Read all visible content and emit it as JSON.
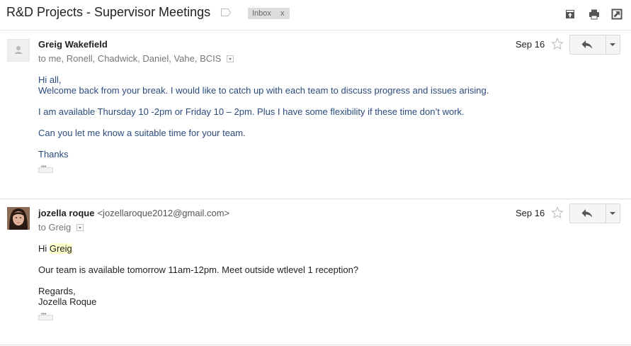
{
  "subject": "R&D Projects - Supervisor Meetings",
  "inbox_chip": {
    "label": "Inbox",
    "close": "x"
  },
  "header_icons": [
    "archive-icon",
    "print-icon",
    "new-window-icon"
  ],
  "messages": [
    {
      "sender": "Greig Wakefield",
      "sender_email": "",
      "recipients": "to me, Ronell, Chadwick, Daniel, Vahe, BCIS",
      "date": "Sep 16",
      "avatar": "default-avatar",
      "body": [
        "Hi all,",
        "Welcome back from your break. I would like to catch up with each team to discuss progress and issues arising.",
        "I am available Thursday 10 -2pm or Friday 10 – 2pm. Plus I have some flexibility if these time don’t work.",
        "Can you let me know a suitable time for your team.",
        "Thanks"
      ]
    },
    {
      "sender": "jozella roque",
      "sender_email": "<jozellaroque2012@gmail.com>",
      "recipients": "to Greig",
      "date": "Sep 16",
      "avatar": "profile-photo",
      "body_greeting": "Hi",
      "body_greeting_name": "Greig",
      "body": [
        "Our team is available tomorrow 11am-12pm. Meet outside wtlevel 1 reception?",
        "Regards,",
        "Jozella Roque"
      ]
    }
  ],
  "colors": {
    "body_text_first": "#2a4b7c",
    "highlight": "#ffffcc",
    "chip_bg": "#dddddd"
  }
}
